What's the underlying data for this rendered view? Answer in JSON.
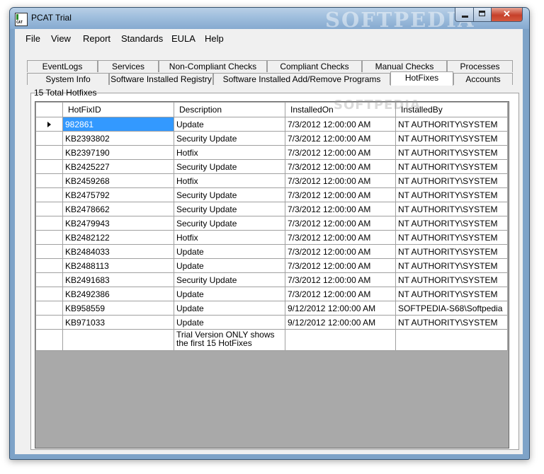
{
  "window": {
    "title": "PCAT Trial",
    "icon_text": "CAT",
    "watermark": "SOFTPEDIA"
  },
  "menu": [
    "File",
    "View",
    "Report",
    "Standards",
    "EULA",
    "Help"
  ],
  "tabs_top": [
    "EventLogs",
    "Services",
    "Non-Compliant Checks",
    "Compliant Checks",
    "Manual Checks",
    "Processes"
  ],
  "tabs_bottom": [
    "System Info",
    "Software Installed Registry",
    "Software Installed Add/Remove Programs",
    "HotFixes",
    "Accounts"
  ],
  "active_tab": "HotFixes",
  "total_label": "15 Total Hotfixes",
  "grid_watermark": "SOFTPEDIA",
  "grid": {
    "columns": [
      "HotFixID",
      "Description",
      "InstalledOn",
      "InstalledBy"
    ],
    "rows": [
      [
        "982861",
        "Update",
        "7/3/2012 12:00:00 AM",
        "NT AUTHORITY\\SYSTEM"
      ],
      [
        "KB2393802",
        "Security Update",
        "7/3/2012 12:00:00 AM",
        "NT AUTHORITY\\SYSTEM"
      ],
      [
        "KB2397190",
        "Hotfix",
        "7/3/2012 12:00:00 AM",
        "NT AUTHORITY\\SYSTEM"
      ],
      [
        "KB2425227",
        "Security Update",
        "7/3/2012 12:00:00 AM",
        "NT AUTHORITY\\SYSTEM"
      ],
      [
        "KB2459268",
        "Hotfix",
        "7/3/2012 12:00:00 AM",
        "NT AUTHORITY\\SYSTEM"
      ],
      [
        "KB2475792",
        "Security Update",
        "7/3/2012 12:00:00 AM",
        "NT AUTHORITY\\SYSTEM"
      ],
      [
        "KB2478662",
        "Security Update",
        "7/3/2012 12:00:00 AM",
        "NT AUTHORITY\\SYSTEM"
      ],
      [
        "KB2479943",
        "Security Update",
        "7/3/2012 12:00:00 AM",
        "NT AUTHORITY\\SYSTEM"
      ],
      [
        "KB2482122",
        "Hotfix",
        "7/3/2012 12:00:00 AM",
        "NT AUTHORITY\\SYSTEM"
      ],
      [
        "KB2484033",
        "Update",
        "7/3/2012 12:00:00 AM",
        "NT AUTHORITY\\SYSTEM"
      ],
      [
        "KB2488113",
        "Update",
        "7/3/2012 12:00:00 AM",
        "NT AUTHORITY\\SYSTEM"
      ],
      [
        "KB2491683",
        "Security Update",
        "7/3/2012 12:00:00 AM",
        "NT AUTHORITY\\SYSTEM"
      ],
      [
        "KB2492386",
        "Update",
        "7/3/2012 12:00:00 AM",
        "NT AUTHORITY\\SYSTEM"
      ],
      [
        "KB958559",
        "Update",
        "9/12/2012 12:00:00 AM",
        "SOFTPEDIA-S68\\Softpedia"
      ],
      [
        "KB971033",
        "Update",
        "9/12/2012 12:00:00 AM",
        "NT AUTHORITY\\SYSTEM"
      ]
    ],
    "trial_note": "Trial Version ONLY shows the first 15 HotFixes"
  },
  "colors": {
    "selection": "#3399ff",
    "grid_background": "#a9a9a9",
    "title_bar": "#9fbedd"
  }
}
